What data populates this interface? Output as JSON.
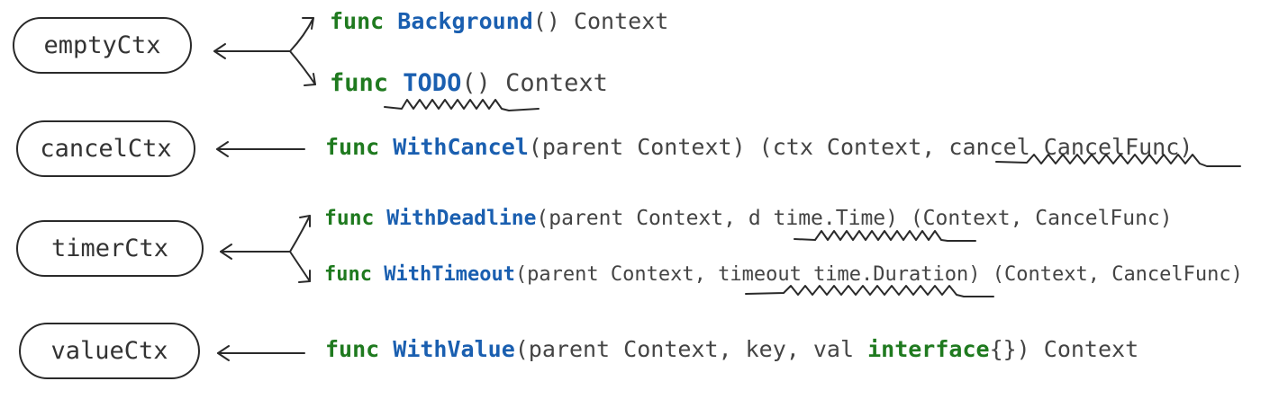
{
  "types": [
    {
      "id": "empty",
      "label": "emptyCtx"
    },
    {
      "id": "cancel",
      "label": "cancelCtx"
    },
    {
      "id": "timer",
      "label": "timerCtx"
    },
    {
      "id": "value",
      "label": "valueCtx"
    }
  ],
  "funcs": {
    "background": {
      "kw": "func",
      "name": "Background",
      "rest": "() Context"
    },
    "todo": {
      "kw": "func",
      "name": "TODO",
      "rest": "() Context"
    },
    "with_cancel": {
      "kw": "func",
      "name": "WithCancel",
      "rest": "(parent Context) (ctx Context, cancel CancelFunc)"
    },
    "with_deadline": {
      "kw": "func",
      "name": "WithDeadline",
      "rest": "(parent Context, d time.Time) (Context, CancelFunc)"
    },
    "with_timeout": {
      "kw": "func",
      "name": "WithTimeout",
      "rest": "(parent Context, timeout time.Duration) (Context, CancelFunc)"
    },
    "with_value": {
      "kw": "func",
      "name": "WithValue",
      "rest_a": "(parent Context, key, val ",
      "kw2": "interface",
      "rest_b": "{}) Context"
    }
  },
  "colors": {
    "keyword": "#1f7a1f",
    "func_name": "#1a5fb0",
    "text": "#444444",
    "stroke": "#2a2a2a"
  }
}
